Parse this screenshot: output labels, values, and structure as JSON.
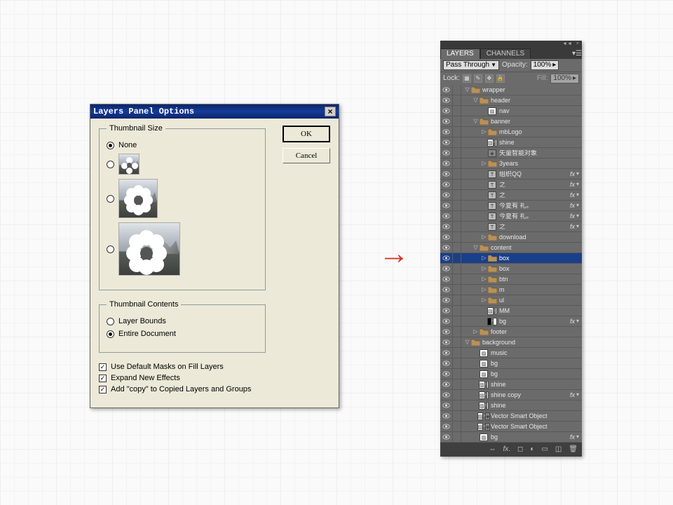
{
  "dialog": {
    "title": "Layers Panel Options",
    "thumbnail_size_legend": "Thumbnail Size",
    "none_label": "None",
    "thumbnail_contents_legend": "Thumbnail Contents",
    "layer_bounds_label": "Layer Bounds",
    "entire_document_label": "Entire Document",
    "check1": "Use Default Masks on Fill Layers",
    "check2": "Expand New Effects",
    "check3": "Add \"copy\" to Copied Layers and Groups",
    "ok": "OK",
    "cancel": "Cancel"
  },
  "panel": {
    "tab1": "LAYERS",
    "tab2": "CHANNELS",
    "blend_mode": "Pass Through",
    "opacity_label": "Opacity:",
    "opacity_value": "100%",
    "lock_label": "Lock:",
    "fill_label": "Fill:",
    "fill_value": "100%",
    "layers": [
      {
        "d": 0,
        "exp": "▽",
        "ico": "folder-open",
        "name": "wrapper"
      },
      {
        "d": 1,
        "exp": "▽",
        "ico": "folder-open",
        "name": "header"
      },
      {
        "d": 2,
        "exp": "",
        "ico": "mask",
        "name": "nav"
      },
      {
        "d": 1,
        "exp": "▽",
        "ico": "folder-open",
        "name": "banner"
      },
      {
        "d": 2,
        "exp": "▷",
        "ico": "folder",
        "name": "mbLogo"
      },
      {
        "d": 2,
        "exp": "",
        "ico": "mask-l",
        "name": "shine"
      },
      {
        "d": 2,
        "exp": "",
        "ico": "smart",
        "name": "矢量智能对象"
      },
      {
        "d": 2,
        "exp": "▷",
        "ico": "folder",
        "name": "3years"
      },
      {
        "d": 2,
        "exp": "",
        "ico": "text",
        "name": "组织QQ",
        "fx": true
      },
      {
        "d": 2,
        "exp": "",
        "ico": "text",
        "name": "之",
        "fx": true
      },
      {
        "d": 2,
        "exp": "",
        "ico": "text",
        "name": "之",
        "fx": true
      },
      {
        "d": 2,
        "exp": "",
        "ico": "text",
        "name": "今夏有   礼。",
        "fx": true
      },
      {
        "d": 2,
        "exp": "",
        "ico": "text",
        "name": "今夏有   礼。",
        "fx": true
      },
      {
        "d": 2,
        "exp": "",
        "ico": "text",
        "name": "之",
        "fx": true
      },
      {
        "d": 2,
        "exp": "▷",
        "ico": "folder",
        "name": "download"
      },
      {
        "d": 1,
        "exp": "▽",
        "ico": "folder-open",
        "name": "content"
      },
      {
        "d": 2,
        "exp": "▷",
        "ico": "folder-sel",
        "name": "box",
        "sel": true
      },
      {
        "d": 2,
        "exp": "▷",
        "ico": "folder",
        "name": "box"
      },
      {
        "d": 2,
        "exp": "▷",
        "ico": "folder",
        "name": "btn"
      },
      {
        "d": 2,
        "exp": "▷",
        "ico": "folder",
        "name": "m"
      },
      {
        "d": 2,
        "exp": "▷",
        "ico": "folder",
        "name": "ul"
      },
      {
        "d": 2,
        "exp": "",
        "ico": "mask-l",
        "name": "MM"
      },
      {
        "d": 2,
        "exp": "",
        "ico": "fill-black",
        "name": "bg",
        "fx": true
      },
      {
        "d": 1,
        "exp": "▷",
        "ico": "folder",
        "name": "footer"
      },
      {
        "d": 0,
        "exp": "▽",
        "ico": "folder-open",
        "name": "background"
      },
      {
        "d": 1,
        "exp": "",
        "ico": "mask",
        "name": "music"
      },
      {
        "d": 1,
        "exp": "",
        "ico": "mask",
        "name": "bg"
      },
      {
        "d": 1,
        "exp": "",
        "ico": "mask",
        "name": "bg"
      },
      {
        "d": 1,
        "exp": "",
        "ico": "mask-l",
        "name": "shine"
      },
      {
        "d": 1,
        "exp": "",
        "ico": "mask-l",
        "name": "shine copy",
        "fx": true
      },
      {
        "d": 1,
        "exp": "",
        "ico": "mask-l",
        "name": "shine"
      },
      {
        "d": 1,
        "exp": "",
        "ico": "smart-l",
        "name": "Vector Smart Object"
      },
      {
        "d": 1,
        "exp": "",
        "ico": "smart-l",
        "name": "Vector Smart Object"
      },
      {
        "d": 1,
        "exp": "",
        "ico": "mask",
        "name": "bg",
        "fx": true
      }
    ]
  }
}
